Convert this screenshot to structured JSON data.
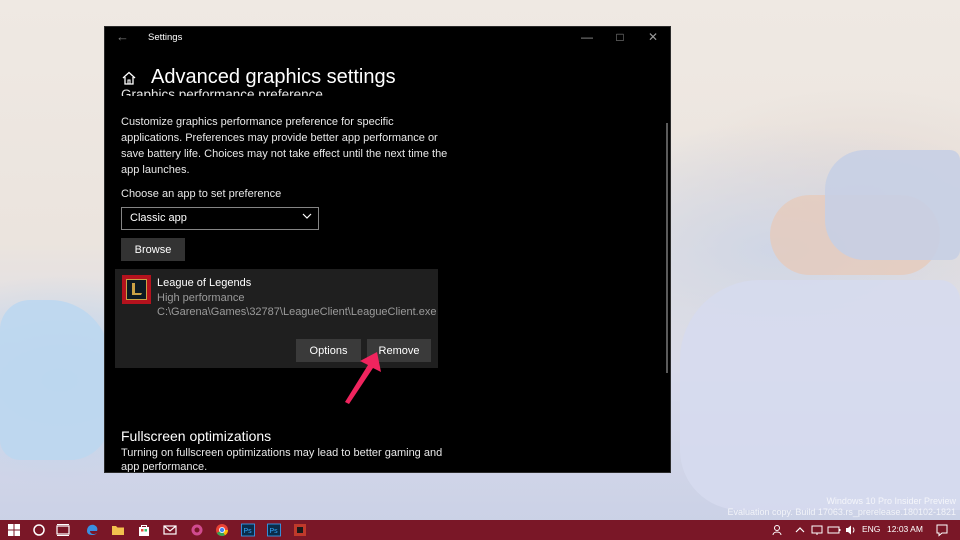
{
  "window": {
    "title": "Settings",
    "page_title": "Advanced graphics settings",
    "section_title": "Graphics performance preference",
    "description": "Customize graphics performance preference for specific applications. Preferences may provide better app performance or save battery life. Choices may not take effect until the next time the app launches.",
    "choose_label": "Choose an app to set preference",
    "dropdown_value": "Classic app",
    "browse_label": "Browse",
    "app": {
      "name": "League of Legends",
      "preference": "High performance",
      "path": "C:\\Garena\\Games\\32787\\LeagueClient\\LeagueClient.exe",
      "options_label": "Options",
      "remove_label": "Remove"
    },
    "fullscreen_title": "Fullscreen optimizations",
    "fullscreen_desc": "Turning on fullscreen optimizations may lead to better gaming and app performance."
  },
  "watermark": {
    "line1": "Windows 10 Pro Insider Preview",
    "line2": "Evaluation copy. Build 17063.rs_prerelease.180102-1821"
  },
  "taskbar": {
    "language": "ENG",
    "time": "12:03 AM"
  },
  "colors": {
    "taskbar": "#7a1727",
    "arrow": "#f0245e",
    "window_bg": "#000000"
  }
}
